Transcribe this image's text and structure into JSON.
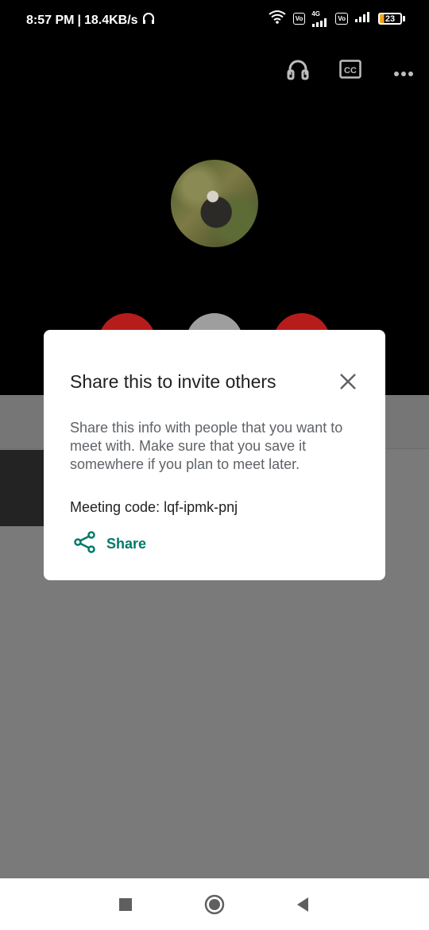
{
  "status_bar": {
    "time": "8:57 PM",
    "separator": "|",
    "net_speed": "18.4KB/s",
    "sim1_badge_top": "Vo",
    "sim1_badge_bottom": "LTE",
    "sim1_network": "4G",
    "sim2_badge_top": "Vo",
    "sim2_badge_bottom": "LTE",
    "battery_level": "23",
    "icons": [
      "headset-notification-icon",
      "wifi-icon",
      "volte-icon",
      "signal-icon",
      "battery-icon"
    ]
  },
  "call_controls": {
    "icons": [
      "headphones-icon",
      "closed-captions-icon",
      "more-options-icon"
    ],
    "cc_label": "CC",
    "button_colors": [
      "#b71c1c",
      "#9e9e9e",
      "#b71c1c"
    ]
  },
  "dialog": {
    "title": "Share this to invite others",
    "description": "Share this info with people that you want to meet with. Make sure that you save it somewhere if you plan to meet later.",
    "meeting_code_label": "Meeting code:",
    "meeting_code": "lqf-ipmk-pnj",
    "share_label": "Share",
    "accent_color": "#00796b"
  },
  "nav_bar": {
    "icons": [
      "recents-square-icon",
      "home-circle-icon",
      "back-triangle-icon"
    ]
  }
}
